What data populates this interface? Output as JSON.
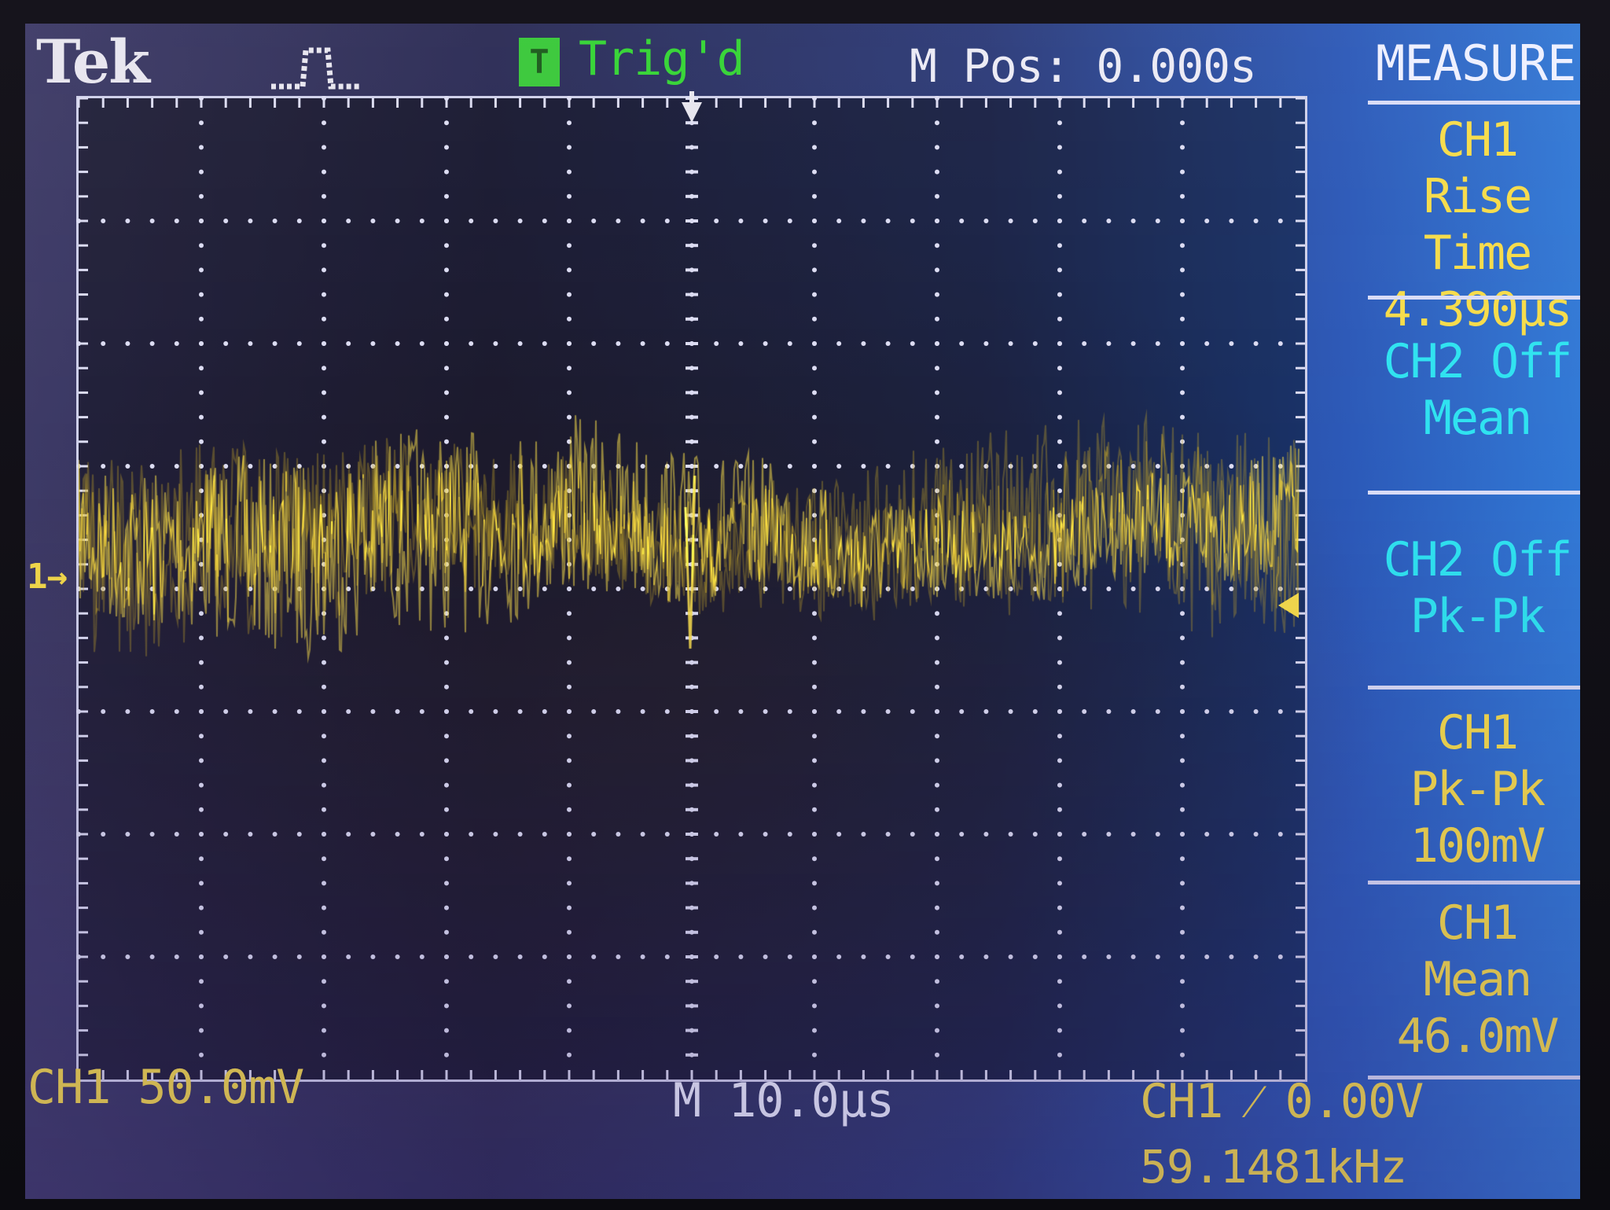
{
  "header": {
    "logo": "Tek",
    "acquisition_icon": "run-pulse-icon",
    "trigger_badge": "T",
    "trigger_status": "Trig'd",
    "main_position": "M Pos: 0.000s"
  },
  "measure_menu": {
    "title": "MEASURE",
    "items": [
      {
        "line1": "CH1",
        "line2": "Rise Time",
        "line3": "4.390µs",
        "color": "#f6dc4a"
      },
      {
        "line1": "CH2 Off",
        "line2": "Mean",
        "line3": "",
        "color": "#2fe3f0"
      },
      {
        "line1": "CH2 Off",
        "line2": "Pk-Pk",
        "line3": "",
        "color": "#2fe3f0"
      },
      {
        "line1": "CH1",
        "line2": "Pk-Pk",
        "line3": "100mV",
        "color": "#f6dc4a"
      },
      {
        "line1": "CH1",
        "line2": "Mean",
        "line3": "46.0mV",
        "color": "#f6dc4a"
      }
    ]
  },
  "footer": {
    "ch1_scale": "CH1  50.0mV",
    "timebase": "M 10.0µs",
    "trigger": "CH1 ⁄ 0.00V",
    "frequency": "59.1481kHz"
  },
  "markers": {
    "ch1_ground": "1→"
  },
  "colors": {
    "ch1": "#f6dc4a",
    "ch2": "#2fe3f0",
    "trigger": "#33d433",
    "graticule": "#dcdcf2"
  }
}
